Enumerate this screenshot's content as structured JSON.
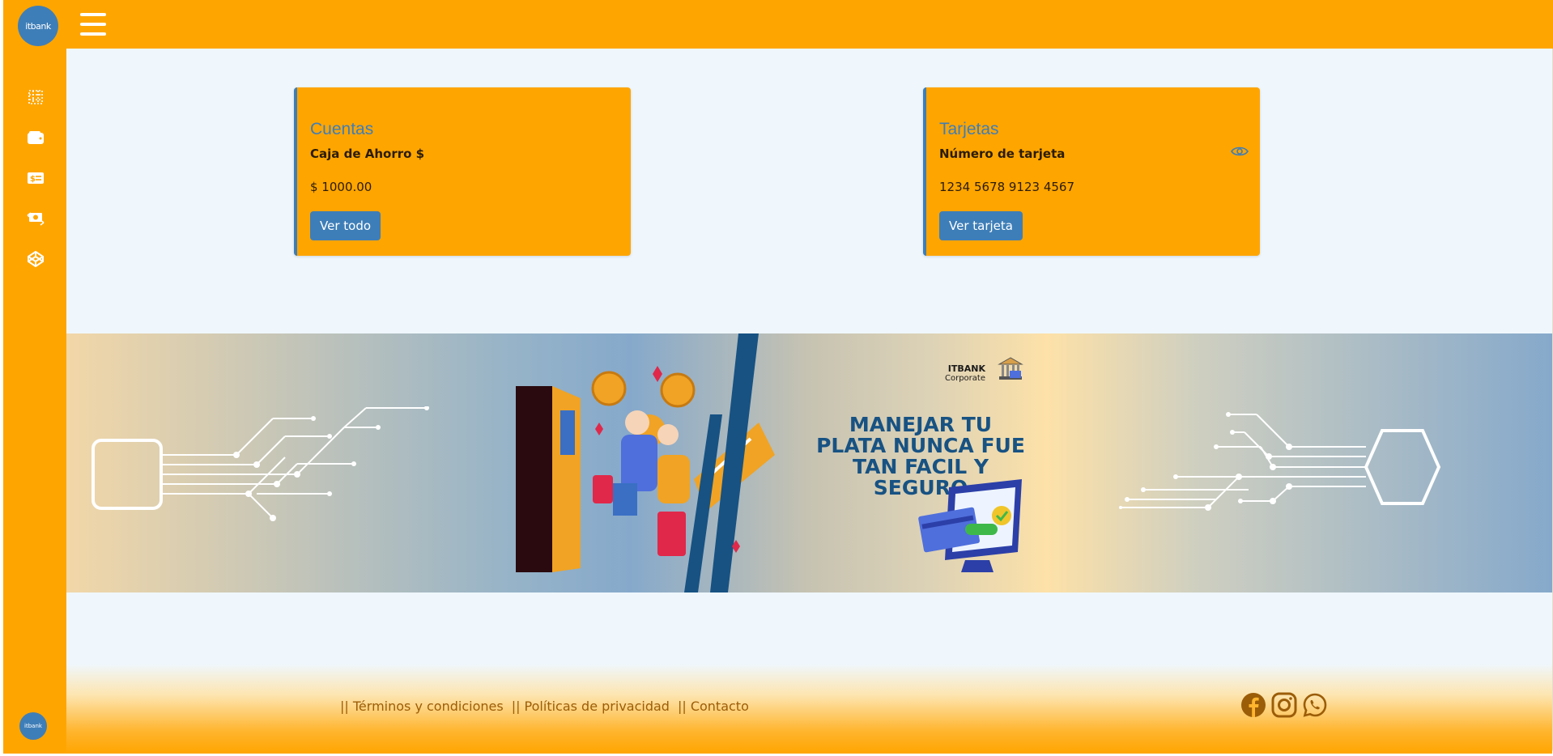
{
  "brand": {
    "logo_text": "itbank",
    "colors": {
      "primary": "#FFA500",
      "accent": "#3E7EB8",
      "background": "#EFF7FD"
    }
  },
  "sidebar": {
    "icons": [
      {
        "name": "dashboard-icon"
      },
      {
        "name": "wallet-icon"
      },
      {
        "name": "dollar-card-icon"
      },
      {
        "name": "money-transfer-icon"
      },
      {
        "name": "codepen-icon"
      }
    ],
    "bottom_logo_text": "itbank"
  },
  "cards": {
    "cuentas": {
      "title": "Cuentas",
      "subtitle": "Caja de Ahorro $",
      "value": "$ 1000.00",
      "button": "Ver todo"
    },
    "tarjetas": {
      "title": "Tarjetas",
      "subtitle": "Número de tarjeta",
      "value": "1234 5678 9123 4567",
      "button": "Ver tarjeta"
    }
  },
  "banner": {
    "headline": "MANEJAR TU PLATA NUNCA FUE TAN FACIL Y SEGURO",
    "brand_name": "ITBANK",
    "brand_sub": "Corporate"
  },
  "footer": {
    "links": [
      "|| Términos y condiciones",
      "|| Políticas de privacidad",
      "|| Contacto"
    ],
    "socials": [
      "facebook-icon",
      "instagram-icon",
      "whatsapp-icon"
    ]
  }
}
